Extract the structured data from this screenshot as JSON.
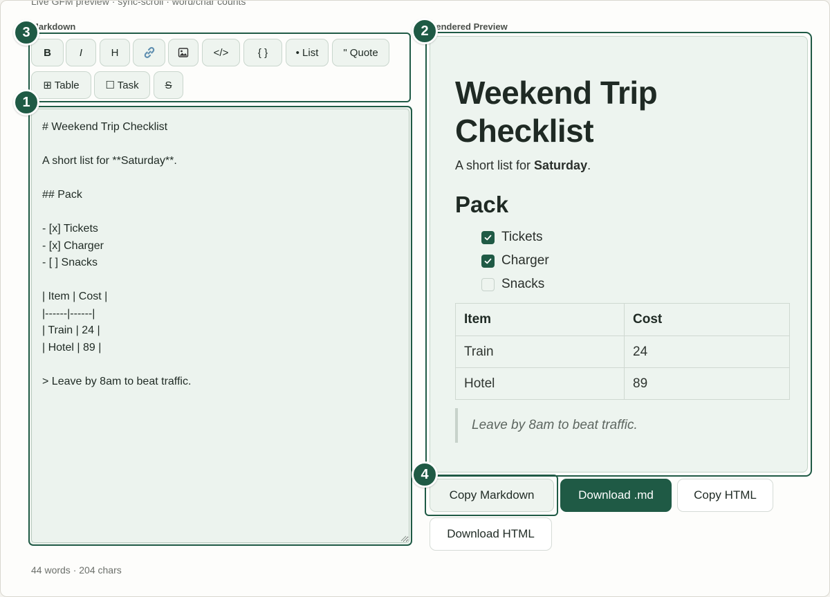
{
  "header": {
    "subtitle": "Live GFM preview · sync-scroll · word/char counts"
  },
  "labels": {
    "markdown": "Markdown",
    "preview": "Rendered Preview"
  },
  "toolbar": {
    "bold": "B",
    "italic": "I",
    "heading": "H",
    "code": "</>",
    "code_block": "{ }",
    "list": "• List",
    "quote": "\" Quote",
    "table": "⊞ Table",
    "task": "☐ Task",
    "strike": "S"
  },
  "editor": {
    "content": "# Weekend Trip Checklist\n\nA short list for **Saturday**.\n\n## Pack\n\n- [x] Tickets\n- [x] Charger\n- [ ] Snacks\n\n| Item | Cost |\n|------|------|\n| Train | 24 |\n| Hotel | 89 |\n\n> Leave by 8am to beat traffic."
  },
  "counts": "44 words · 204 chars",
  "preview": {
    "h1": "Weekend Trip Checklist",
    "para_prefix": "A short list for ",
    "para_bold": "Saturday",
    "para_suffix": ".",
    "h2": "Pack",
    "tasks": [
      {
        "label": "Tickets",
        "checked": true
      },
      {
        "label": "Charger",
        "checked": true
      },
      {
        "label": "Snacks",
        "checked": false
      }
    ],
    "table": {
      "headers": [
        "Item",
        "Cost"
      ],
      "rows": [
        [
          "Train",
          "24"
        ],
        [
          "Hotel",
          "89"
        ]
      ]
    },
    "quote": "Leave by 8am to beat traffic."
  },
  "actions": {
    "copy_markdown": "Copy Markdown",
    "download_md": "Download .md",
    "copy_html": "Copy HTML",
    "download_html": "Download HTML"
  },
  "badges": [
    "1",
    "2",
    "3",
    "4"
  ],
  "colors": {
    "accent": "#1f5a45",
    "panel": "#edf4ef",
    "background": "#fdfdfb"
  }
}
